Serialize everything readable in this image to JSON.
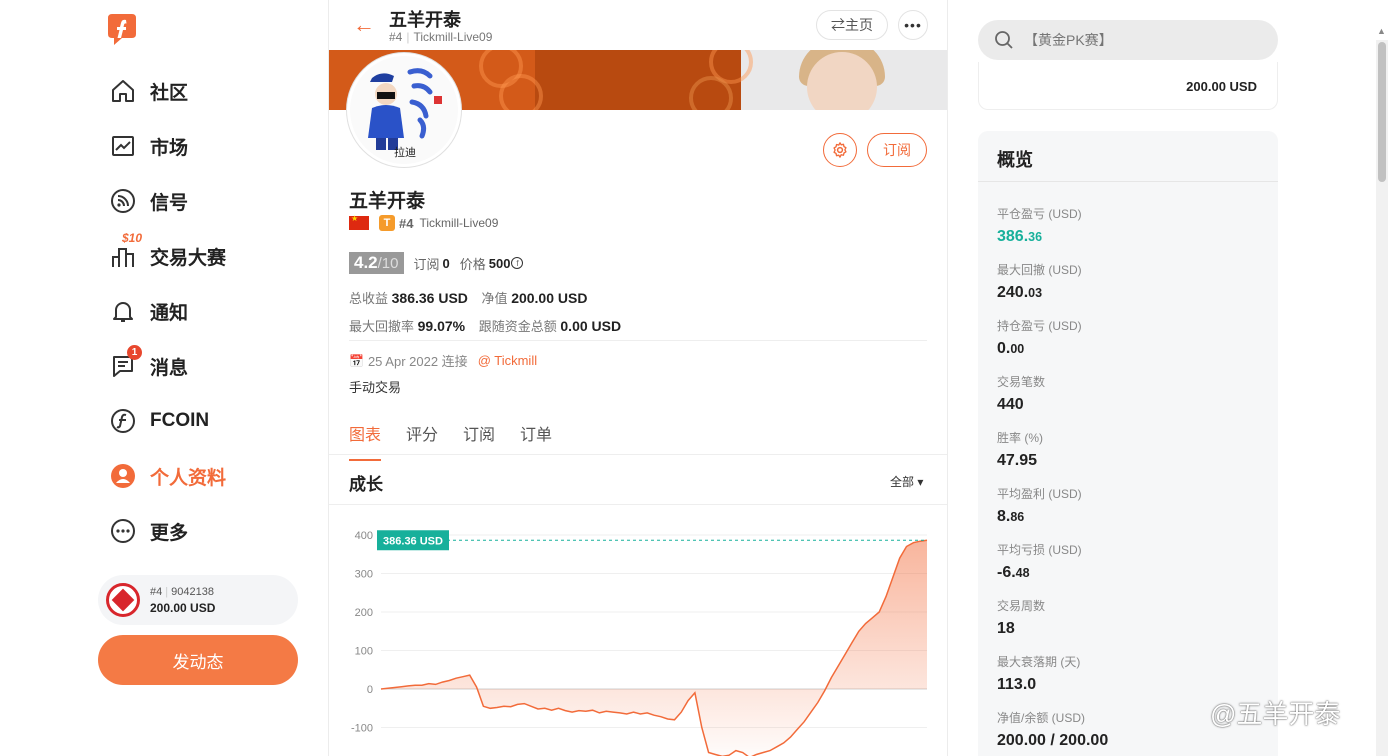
{
  "nav": {
    "items": [
      {
        "label": "社区",
        "icon": "home-icon"
      },
      {
        "label": "市场",
        "icon": "chart-line-icon"
      },
      {
        "label": "信号",
        "icon": "rss-icon"
      },
      {
        "label": "交易大赛",
        "icon": "trophy-bars-icon",
        "tag": "$10"
      },
      {
        "label": "通知",
        "icon": "bell-icon"
      },
      {
        "label": "消息",
        "icon": "message-icon",
        "badge": "1"
      },
      {
        "label": "FCOIN",
        "icon": "fcoin-icon"
      },
      {
        "label": "个人资料",
        "icon": "user-icon",
        "active": true
      },
      {
        "label": "更多",
        "icon": "more-icon"
      }
    ],
    "account": {
      "rank": "#4",
      "id": "9042138",
      "balance": "200.00 USD"
    },
    "post_button": "发动态"
  },
  "header": {
    "title": "五羊开泰",
    "rank": "#4",
    "account": "Tickmill-Live09",
    "home_button": "⇄主页",
    "more_button": "•••"
  },
  "profile": {
    "name": "五羊开泰",
    "rank": "#4",
    "account": "Tickmill-Live09",
    "t_badge": "T",
    "rating": "4.2",
    "rating_max": "/10",
    "subscribe_label": "订阅",
    "subscribe_count": "0",
    "price_label": "价格",
    "price": "500",
    "total_profit_label": "总收益",
    "total_profit": "386.36 USD",
    "net_value_label": "净值",
    "net_value": "200.00 USD",
    "max_drawdown_label": "最大回撤率",
    "max_drawdown": "99.07%",
    "follow_funds_label": "跟随资金总额",
    "follow_funds": "0.00 USD",
    "join_date": "25 Apr 2022 连接",
    "broker": "@ Tickmill",
    "description": "手动交易",
    "subscribe_button": "订阅"
  },
  "tabs": [
    "图表",
    "评分",
    "订阅",
    "订单"
  ],
  "growth": {
    "title": "成长",
    "filter": "全部"
  },
  "chart_data": {
    "type": "area",
    "current_label": "386.36 USD",
    "current_value": 386.36,
    "yticks": [
      "400",
      "300",
      "200",
      "100",
      "0",
      "-100"
    ],
    "ylim": [
      -100,
      400
    ],
    "x": [
      0,
      1,
      2,
      3,
      4,
      5,
      6,
      7,
      8,
      9,
      10,
      11,
      12,
      13,
      14,
      15,
      16,
      17,
      18,
      19,
      20,
      21,
      22,
      23,
      24,
      25,
      26,
      27,
      28,
      29,
      30,
      31,
      32,
      33,
      34,
      35,
      36,
      37,
      38,
      39,
      40,
      41,
      42,
      43,
      44,
      45,
      46,
      47,
      48,
      49,
      50,
      51,
      52,
      53,
      54,
      55,
      56,
      57,
      58,
      59,
      60,
      61,
      62,
      63,
      64,
      65,
      66,
      67,
      68,
      69,
      70,
      71,
      72,
      73,
      74,
      75,
      76,
      77,
      78,
      79,
      80
    ],
    "values": [
      0,
      2,
      4,
      6,
      8,
      10,
      10,
      14,
      12,
      18,
      22,
      28,
      32,
      36,
      5,
      -45,
      -50,
      -48,
      -45,
      -46,
      -40,
      -38,
      -45,
      -52,
      -50,
      -55,
      -50,
      -56,
      -60,
      -56,
      -58,
      -55,
      -62,
      -58,
      -60,
      -62,
      -65,
      -60,
      -65,
      -62,
      -68,
      -72,
      -78,
      -80,
      -60,
      -30,
      -10,
      -100,
      -165,
      -170,
      -175,
      -172,
      -160,
      -165,
      -178,
      -170,
      -165,
      -160,
      -150,
      -140,
      -125,
      -105,
      -85,
      -60,
      -35,
      -5,
      30,
      60,
      90,
      120,
      150,
      170,
      185,
      200,
      240,
      290,
      340,
      370,
      380,
      384,
      386.36
    ]
  },
  "search": {
    "placeholder": "【黄金PK赛】"
  },
  "balance_card": {
    "value": "200.00 USD"
  },
  "overview": {
    "title": "概览",
    "items": [
      {
        "label": "平仓盈亏 (USD)",
        "main": "386.",
        "dec": "36",
        "color": "#17b09b"
      },
      {
        "label": "最大回撤 (USD)",
        "main": "240.",
        "dec": "03"
      },
      {
        "label": "持仓盈亏 (USD)",
        "main": "0.",
        "dec": "00"
      },
      {
        "label": "交易笔数",
        "main": "440",
        "dec": ""
      },
      {
        "label": "胜率 (%)",
        "main": "47.95",
        "dec": ""
      },
      {
        "label": "平均盈利 (USD)",
        "main": "8.",
        "dec": "86"
      },
      {
        "label": "平均亏损 (USD)",
        "main": "-6.",
        "dec": "48"
      },
      {
        "label": "交易周数",
        "main": "18",
        "dec": ""
      },
      {
        "label": "最大衰落期 (天)",
        "main": "113.0",
        "dec": ""
      },
      {
        "label": "净值/余额 (USD)",
        "main": "200.00 / 200.00",
        "dec": ""
      }
    ]
  },
  "watermark": "@五羊开泰",
  "colors": {
    "accent": "#f26b3a",
    "green": "#17b09b",
    "button": "#f47a45"
  }
}
